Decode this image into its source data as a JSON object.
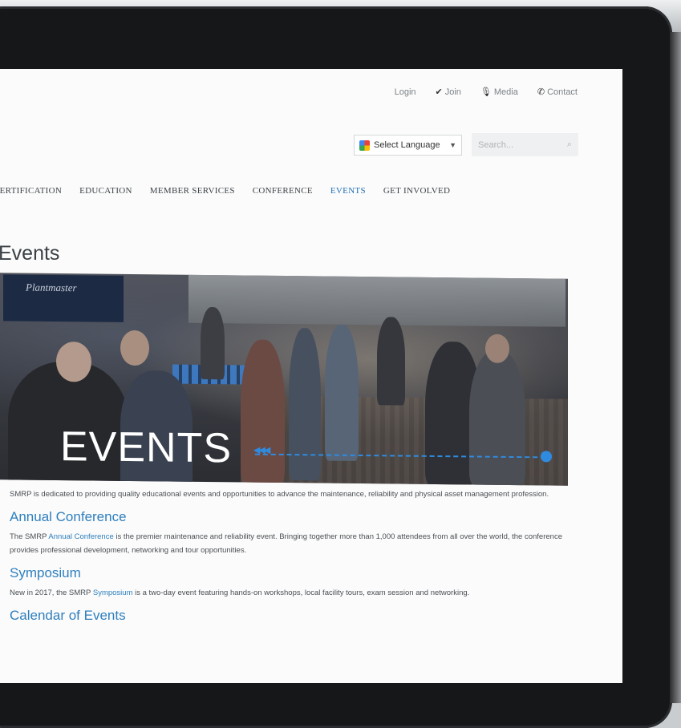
{
  "utility_nav": {
    "login": "Login",
    "join": "Join",
    "media": "Media",
    "contact": "Contact"
  },
  "language": {
    "label": "Select Language",
    "caret": "▼"
  },
  "search": {
    "placeholder": "Search..."
  },
  "main_nav": {
    "items": [
      "CERTIFICATION",
      "EDUCATION",
      "MEMBER SERVICES",
      "CONFERENCE",
      "EVENTS",
      "GET INVOLVED"
    ],
    "active": "EVENTS"
  },
  "page": {
    "title": "Events"
  },
  "hero": {
    "sign_text": "Plantmaster",
    "title": "EVENTS",
    "arrows": "◀◀◀"
  },
  "intro": "SMRP is dedicated to providing quality educational events and opportunities to advance the maintenance, reliability and physical asset management profession.",
  "sections": [
    {
      "heading": "Annual Conference",
      "text_before": "The SMRP ",
      "link": "Annual Conference",
      "text_after": " is the premier maintenance and reliability event. Bringing together more than 1,000 attendees from all over the world, the conference provides professional development, networking and tour opportunities."
    },
    {
      "heading": "Symposium",
      "text_before": "New in 2017, the SMRP ",
      "link": "Symposium",
      "text_after": " is a two-day event featuring hands-on workshops, local facility tours, exam session and networking."
    },
    {
      "heading": "Calendar of Events"
    }
  ],
  "colors": {
    "accent": "#2e7fbe",
    "nav_active": "#1f6fb6",
    "hero_line": "#2f8be0"
  }
}
